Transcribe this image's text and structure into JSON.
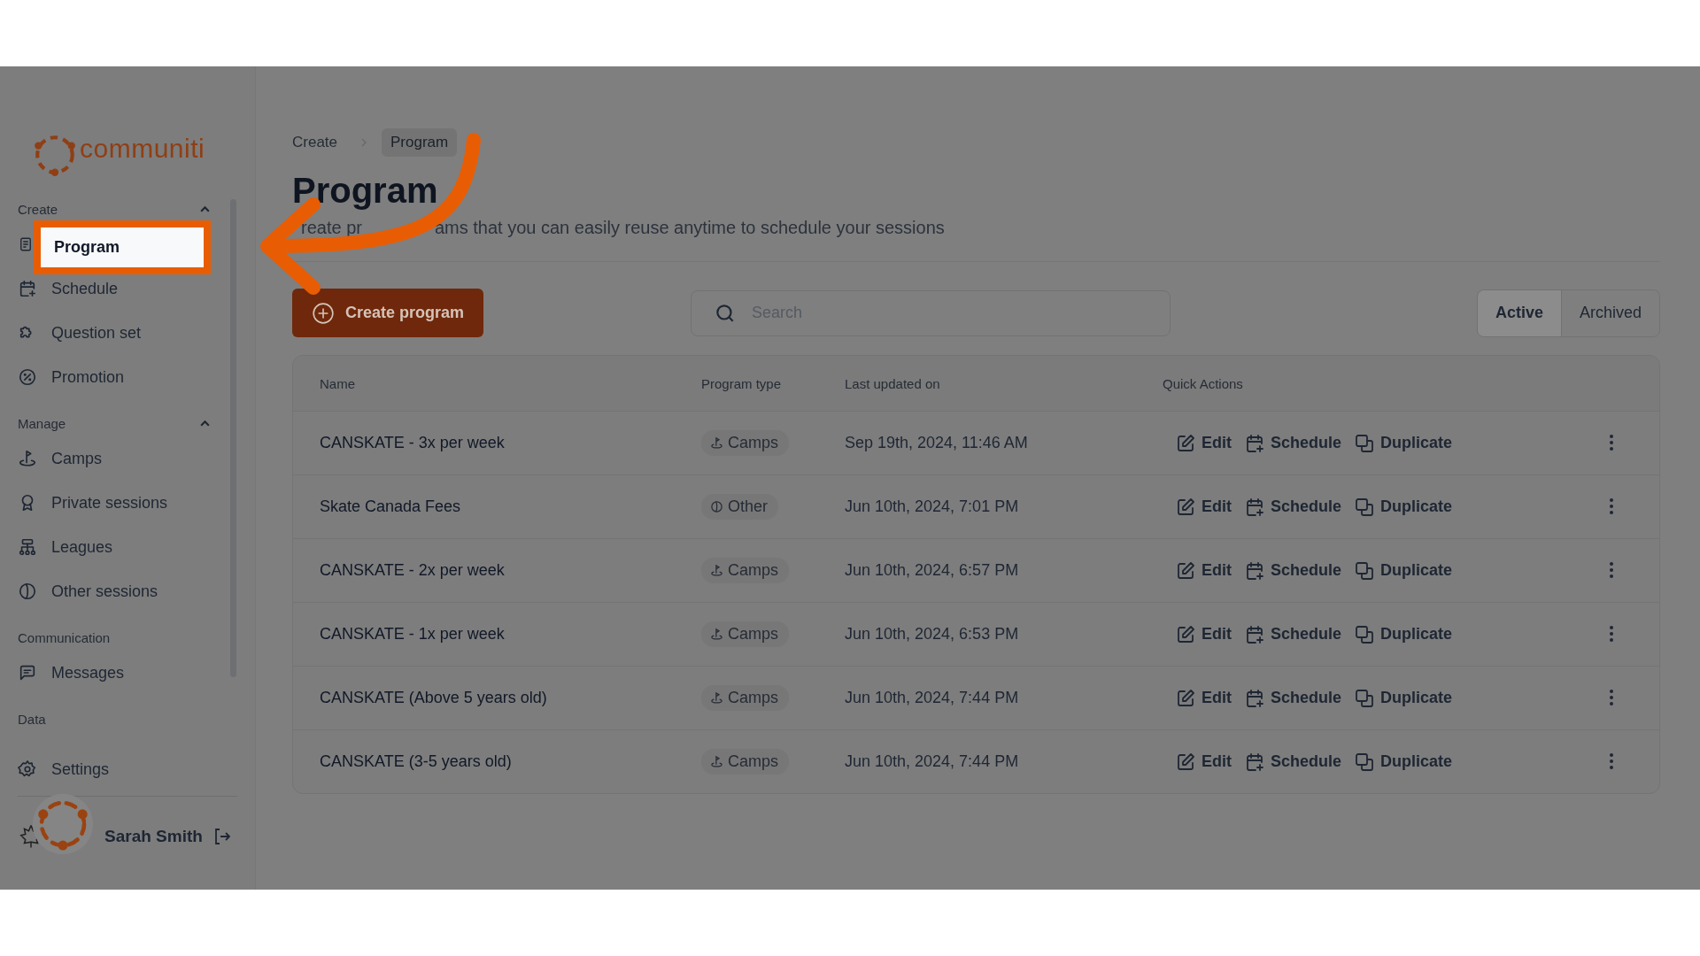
{
  "brand": {
    "name": "communiti"
  },
  "sidebar": {
    "sections": [
      {
        "label": "Create",
        "expanded": true,
        "items": [
          {
            "label": "Program",
            "kind": "program",
            "selected": true
          },
          {
            "label": "Schedule",
            "kind": "schedule",
            "selected": false
          },
          {
            "label": "Question set",
            "kind": "puzzle",
            "selected": false
          },
          {
            "label": "Promotion",
            "kind": "promotion",
            "selected": false
          }
        ]
      },
      {
        "label": "Manage",
        "expanded": true,
        "items": [
          {
            "label": "Camps",
            "kind": "camps",
            "selected": false
          },
          {
            "label": "Private sessions",
            "kind": "award",
            "selected": false
          },
          {
            "label": "Leagues",
            "kind": "leagues",
            "selected": false
          },
          {
            "label": "Other sessions",
            "kind": "other",
            "selected": false
          }
        ]
      },
      {
        "label": "Communication",
        "items": [
          {
            "label": "Messages",
            "kind": "messages",
            "selected": false
          }
        ]
      },
      {
        "label": "Data"
      }
    ],
    "settings": "Settings",
    "user": {
      "name": "Sarah Smith"
    }
  },
  "breadcrumb": [
    {
      "label": "Create",
      "selected": false
    },
    {
      "label": "Program",
      "selected": true
    }
  ],
  "page": {
    "title": "Program",
    "subtitle_parts": [
      "reate pr",
      "ams that you can easily reuse anytime to schedule your sessions"
    ]
  },
  "toolbar": {
    "create_button": "Create program",
    "search": {
      "placeholder": "Search"
    },
    "tabs": [
      {
        "label": "Active",
        "selected": true
      },
      {
        "label": "Archived",
        "selected": false
      }
    ]
  },
  "table": {
    "columns": [
      "Name",
      "Program type",
      "Last updated on",
      "Quick Actions"
    ],
    "rows": [
      {
        "name": "CANSKATE - 3x per week",
        "type": {
          "label": "Camps",
          "kind": "camps"
        },
        "updated": "Sep 19th, 2024, 11:46 AM",
        "actions": [
          {
            "label": "Edit",
            "kind": "edit"
          },
          {
            "label": "Schedule",
            "kind": "schedule"
          },
          {
            "label": "Duplicate",
            "kind": "duplicate"
          }
        ]
      },
      {
        "name": "Skate Canada Fees",
        "type": {
          "label": "Other",
          "kind": "other"
        },
        "updated": "Jun 10th, 2024, 7:01 PM",
        "actions": [
          {
            "label": "Edit",
            "kind": "edit"
          },
          {
            "label": "Schedule",
            "kind": "schedule"
          },
          {
            "label": "Duplicate",
            "kind": "duplicate"
          }
        ]
      },
      {
        "name": "CANSKATE - 2x per week",
        "type": {
          "label": "Camps",
          "kind": "camps"
        },
        "updated": "Jun 10th, 2024, 6:57 PM",
        "actions": [
          {
            "label": "Edit",
            "kind": "edit"
          },
          {
            "label": "Schedule",
            "kind": "schedule"
          },
          {
            "label": "Duplicate",
            "kind": "duplicate"
          }
        ]
      },
      {
        "name": "CANSKATE - 1x per week",
        "type": {
          "label": "Camps",
          "kind": "camps"
        },
        "updated": "Jun 10th, 2024, 6:53 PM",
        "actions": [
          {
            "label": "Edit",
            "kind": "edit"
          },
          {
            "label": "Schedule",
            "kind": "schedule"
          },
          {
            "label": "Duplicate",
            "kind": "duplicate"
          }
        ]
      },
      {
        "name": "CANSKATE (Above 5 years old)",
        "type": {
          "label": "Camps",
          "kind": "camps"
        },
        "updated": "Jun 10th, 2024, 7:44 PM",
        "actions": [
          {
            "label": "Edit",
            "kind": "edit"
          },
          {
            "label": "Schedule",
            "kind": "schedule"
          },
          {
            "label": "Duplicate",
            "kind": "duplicate"
          }
        ]
      },
      {
        "name": "CANSKATE (3-5 years old)",
        "type": {
          "label": "Camps",
          "kind": "camps"
        },
        "updated": "Jun 10th, 2024, 7:44 PM",
        "actions": [
          {
            "label": "Edit",
            "kind": "edit"
          },
          {
            "label": "Schedule",
            "kind": "schedule"
          },
          {
            "label": "Duplicate",
            "kind": "duplicate"
          }
        ]
      }
    ]
  }
}
